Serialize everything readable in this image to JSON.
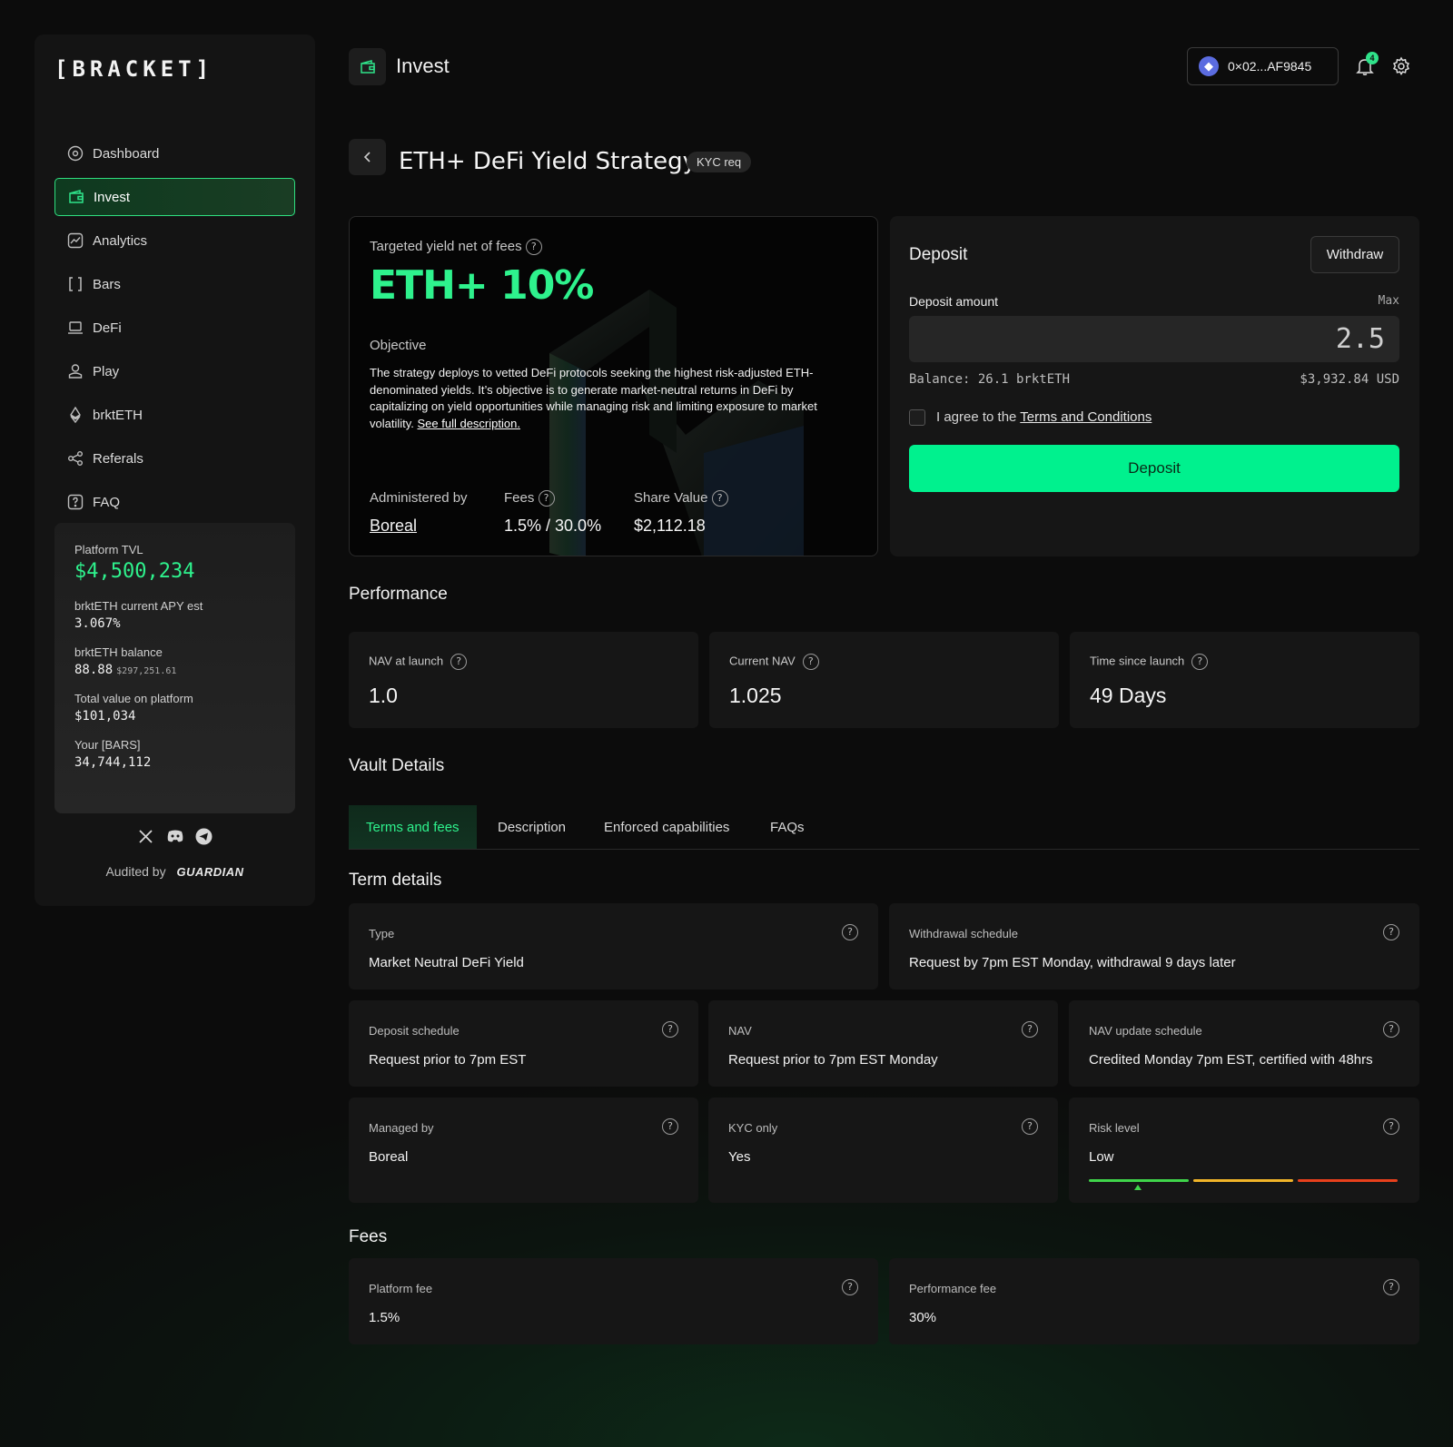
{
  "sidebar": {
    "logo": "[BRACKET]",
    "items": [
      {
        "label": "Dashboard",
        "icon": "dashboard-icon"
      },
      {
        "label": "Invest",
        "icon": "wallet-icon"
      },
      {
        "label": "Analytics",
        "icon": "analytics-icon"
      },
      {
        "label": "Bars",
        "icon": "brackets-icon"
      },
      {
        "label": "DeFi",
        "icon": "laptop-icon"
      },
      {
        "label": "Play",
        "icon": "user-icon"
      },
      {
        "label": "brktETH",
        "icon": "eth-icon"
      },
      {
        "label": "Referals",
        "icon": "share-icon"
      },
      {
        "label": "FAQ",
        "icon": "help-icon"
      }
    ],
    "stats": {
      "tvl_label": "Platform TVL",
      "tvl_value": "$4,500,234",
      "apy_label": "brktETH current APY est",
      "apy_value": "3.067%",
      "balance_label": "brktETH balance",
      "balance_value": "88.88",
      "balance_usd": "$297,251.61",
      "total_label": "Total value on platform",
      "total_value": "$101,034",
      "bars_label": "Your [BARS]",
      "bars_value": "34,744,112"
    },
    "socials": [
      "x-icon",
      "discord-icon",
      "telegram-icon"
    ],
    "audited_label": "Audited by",
    "auditor": "GUARDIAN"
  },
  "header": {
    "title": "Invest",
    "wallet": "0×02...AF9845",
    "notifications": "4"
  },
  "strategy": {
    "title": "ETH+ DeFi Yield Strategy",
    "badge": "KYC req",
    "yield_label": "Targeted yield net of fees",
    "yield_value": "ETH+ 10%",
    "objective_label": "Objective",
    "objective_text": "The strategy deploys to vetted DeFi protocols seeking the highest risk-adjusted ETH-denominated yields. It’s objective is to generate market-neutral returns in DeFi by capitalizing on yield opportunities while managing risk and limiting exposure to market volatility. ",
    "see_full": "See full description.",
    "admin_label": "Administered by",
    "admin_value": "Boreal",
    "fees_label": "Fees",
    "fees_value": "1.5% / 30.0%",
    "share_label": "Share Value",
    "share_value": "$2,112.18"
  },
  "deposit": {
    "title": "Deposit",
    "withdraw": "Withdraw",
    "amount_label": "Deposit amount",
    "max": "Max",
    "amount_value": "2.5",
    "balance": "Balance: 26.1 brktETH",
    "usd": "$3,932.84 USD",
    "agree_prefix": "I agree to the ",
    "agree_link": "Terms and Conditions",
    "button": "Deposit"
  },
  "performance": {
    "title": "Performance",
    "cards": [
      {
        "label": "NAV at launch",
        "value": "1.0"
      },
      {
        "label": "Current NAV",
        "value": "1.025"
      },
      {
        "label": "Time since launch",
        "value": "49 Days"
      }
    ]
  },
  "vault": {
    "title": "Vault Details",
    "tabs": [
      "Terms and fees",
      "Description",
      "Enforced capabilities",
      "FAQs"
    ],
    "term_title": "Term details",
    "terms": [
      {
        "label": "Type",
        "value": "Market Neutral DeFi Yield"
      },
      {
        "label": "Withdrawal schedule",
        "value": "Request by 7pm EST Monday, withdrawal 9 days later"
      },
      {
        "label": "Deposit schedule",
        "value": "Request prior to 7pm EST"
      },
      {
        "label": "NAV",
        "value": "Request prior to 7pm EST Monday"
      },
      {
        "label": "NAV update schedule",
        "value": "Credited Monday 7pm EST, certified with 48hrs"
      },
      {
        "label": "Managed by",
        "value": "Boreal"
      },
      {
        "label": "KYC only",
        "value": "Yes"
      },
      {
        "label": "Risk level",
        "value": "Low"
      }
    ],
    "risk_colors": [
      "#3fd44a",
      "#f0b429",
      "#e8401c"
    ],
    "risk_level_fraction": 0.16,
    "fees_title": "Fees",
    "fees": [
      {
        "label": "Platform fee",
        "value": "1.5%"
      },
      {
        "label": "Performance fee",
        "value": "30%"
      }
    ]
  },
  "colors": {
    "accent": "#2ef28d",
    "button": "#00f18e"
  }
}
